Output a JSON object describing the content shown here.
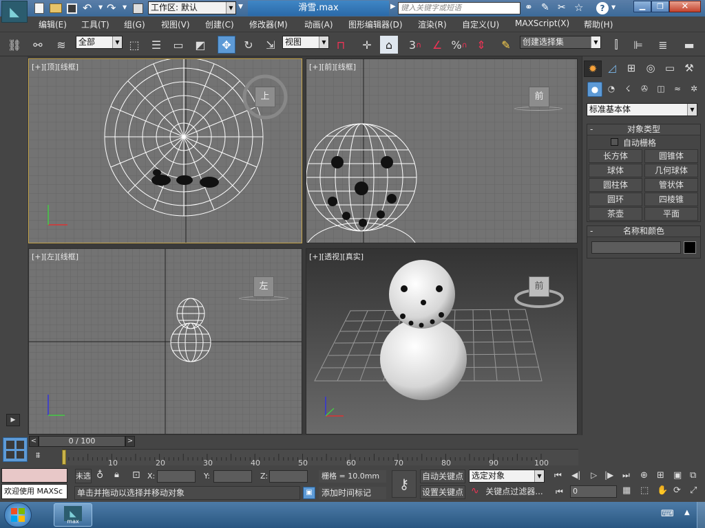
{
  "title": {
    "workspace_label": "工作区: 默认",
    "filename": "滑雪.max",
    "search_placeholder": "键入关键字或短语"
  },
  "menu": [
    "编辑(E)",
    "工具(T)",
    "组(G)",
    "视图(V)",
    "创建(C)",
    "修改器(M)",
    "动画(A)",
    "图形编辑器(D)",
    "渲染(R)",
    "自定义(U)",
    "MAXScript(X)",
    "帮助(H)"
  ],
  "toolbar": {
    "selection_filter": "全部",
    "ref_coord": "视图",
    "snap_label": "3",
    "percent_label": "%",
    "named_selection": "创建选择集"
  },
  "viewports": {
    "top": {
      "label_plus": "[+]",
      "label_view": "[顶]",
      "label_mode": "[线框]",
      "cube": "上"
    },
    "front": {
      "label_plus": "[+]",
      "label_view": "[前]",
      "label_mode": "[线框]",
      "cube": "前"
    },
    "left": {
      "label_plus": "[+]",
      "label_view": "[左]",
      "label_mode": "[线框]",
      "cube": "左"
    },
    "persp": {
      "label_plus": "[+]",
      "label_view": "[透视]",
      "label_mode": "[真实]",
      "cube": "前"
    }
  },
  "command_panel": {
    "category_dropdown": "标准基本体",
    "object_type_title": "对象类型",
    "autogrid_label": "自动栅格",
    "buttons": [
      "长方体",
      "圆锥体",
      "球体",
      "几何球体",
      "圆柱体",
      "管状体",
      "圆环",
      "四棱锥",
      "茶壶",
      "平面"
    ],
    "name_color_title": "名称和颜色",
    "object_color": "#000000"
  },
  "timeline": {
    "frame_display": "0 / 100",
    "ticks": [
      "10",
      "20",
      "30",
      "40",
      "50",
      "60",
      "70",
      "80",
      "90",
      "100"
    ]
  },
  "status": {
    "maxscript_text": "欢迎使用 MAXSc",
    "selection_text": "未选",
    "x_label": "X:",
    "y_label": "Y:",
    "z_label": "Z:",
    "grid_text": "栅格 = 10.0mm",
    "prompt": "单击并拖动以选择并移动对象",
    "add_time_tag": "添加时间标记",
    "auto_key": "自动关键点",
    "set_key": "设置关键点",
    "key_mode_dropdown": "选定对象",
    "key_filters": "关键点过滤器...",
    "frame_value": "0"
  },
  "taskbar": {
    "app_label": "max"
  }
}
